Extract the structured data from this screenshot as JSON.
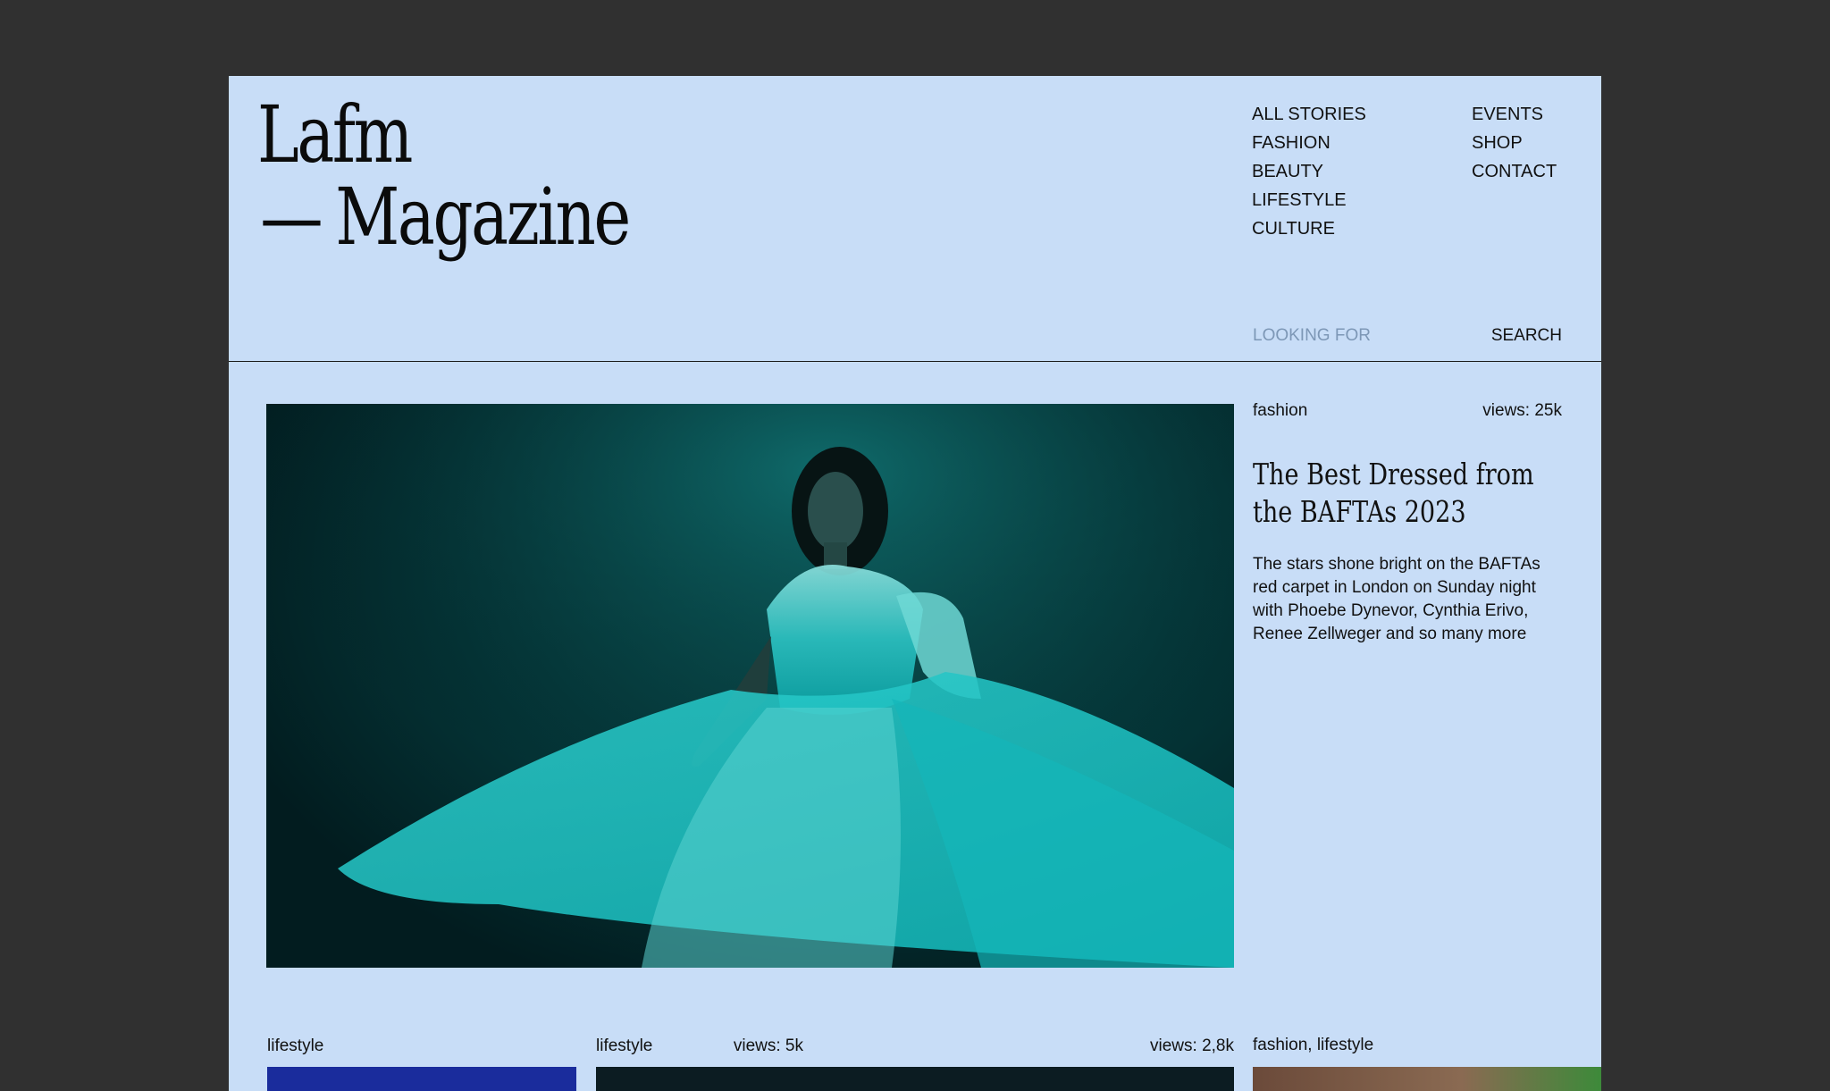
{
  "brand": {
    "line1": "Lafm",
    "dash": "—",
    "line2": "Magazine"
  },
  "nav": {
    "col1": [
      "ALL STORIES",
      "FASHION",
      "BEAUTY",
      "LIFESTYLE",
      "CULTURE"
    ],
    "col2": [
      "EVENTS",
      "SHOP",
      "CONTACT"
    ]
  },
  "search": {
    "placeholder": "LOOKING FOR",
    "button": "SEARCH"
  },
  "featured": {
    "category": "fashion",
    "views": "views: 25k",
    "title": "The Best Dressed from the BAFTAs 2023",
    "excerpt": "The stars shone bright on the BAFTAs red carpet in London on Sunday night with Phoebe Dynevor, Cynthia Erivo, Renee Zellweger and so many more"
  },
  "cards": [
    {
      "category": "lifestyle",
      "views": "views: 5k",
      "thumb_color": "#1a2c9c"
    },
    {
      "category": "lifestyle",
      "views": "views: 2,8k",
      "thumb_color": "#0c1c22"
    },
    {
      "category": "fashion, lifestyle",
      "views": "",
      "thumb_color": "#6b4a3a"
    }
  ],
  "colors": {
    "background": "#303030",
    "page": "#c8ddf7",
    "placeholder": "#7d97b6",
    "text": "#111111"
  }
}
